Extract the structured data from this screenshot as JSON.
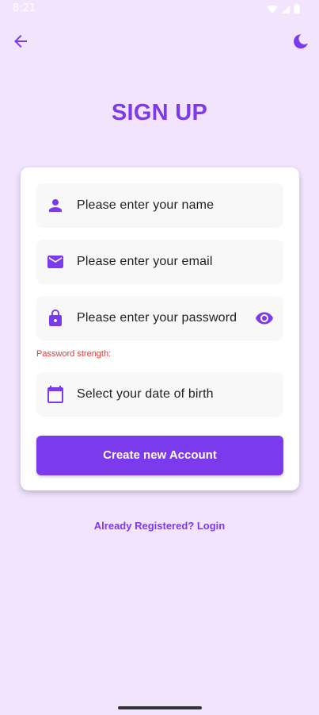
{
  "status_bar": {
    "time": "8:21"
  },
  "app_bar": {
    "back_icon": "arrow-left-icon",
    "theme_icon": "moon-icon"
  },
  "title": "SIGN UP",
  "form": {
    "name_placeholder": "Please enter your name",
    "email_placeholder": "Please enter your email",
    "password_placeholder": "Please enter your password",
    "password_strength_label": "Password strength:",
    "dob_placeholder": "Select your date of birth",
    "submit_label": "Create new Account"
  },
  "login_link": "Already Registered? Login",
  "colors": {
    "background": "#f2e4fd",
    "accent": "#7c3aed",
    "error": "#e53935"
  }
}
